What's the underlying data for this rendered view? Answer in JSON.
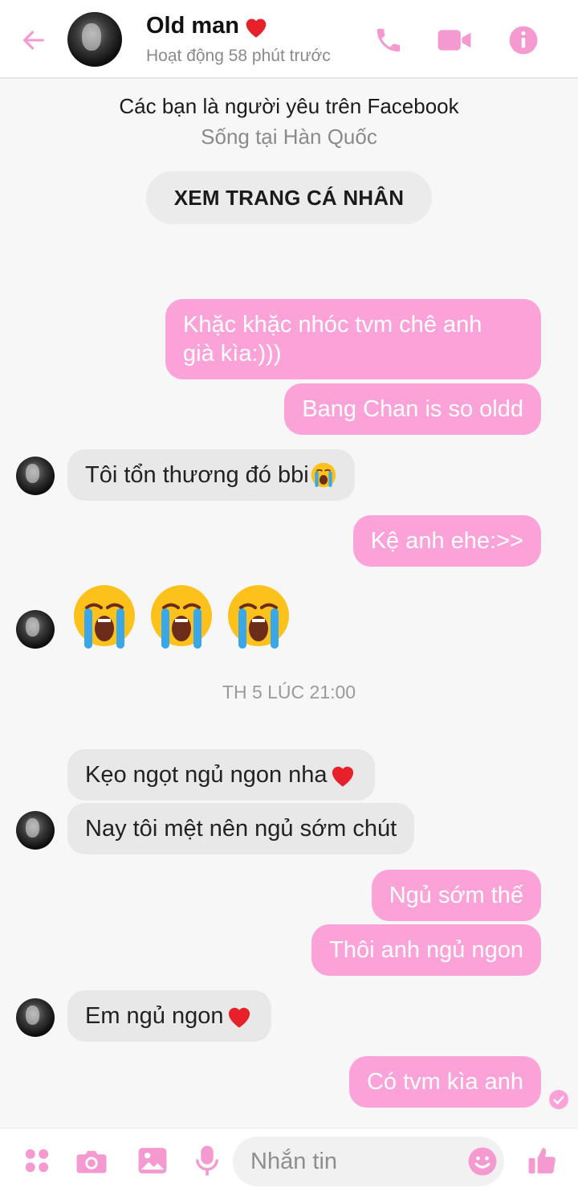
{
  "header": {
    "contact_name": "Old man",
    "status": "Hoạt động 58 phút trước",
    "accent": "#f59ad0",
    "icons": [
      "back-arrow-icon",
      "phone-icon",
      "video-camera-icon",
      "info-icon"
    ]
  },
  "intro": {
    "relationship": "Các bạn là người yêu trên Facebook",
    "location": "Sống tại Hàn Quốc",
    "profile_button": "XEM TRANG CÁ NHÂN"
  },
  "messages": [
    {
      "from": "me",
      "text": "Khặc khặc nhóc tvm chê anh\ngià kìa:)))"
    },
    {
      "from": "me",
      "text": "Bang Chan is so oldd"
    },
    {
      "from": "them",
      "text": "Tôi tổn thương đó bbi"
    },
    {
      "from": "me",
      "text": "Kệ anh ehe:>>"
    },
    {
      "from": "them",
      "text": "",
      "emoji": "loudly-crying-face x3"
    },
    {
      "from": "them",
      "text": "Kẹo ngọt ngủ ngon nha"
    },
    {
      "from": "them",
      "text": "Nay tôi mệt nên ngủ sớm chút"
    },
    {
      "from": "me",
      "text": "Ngủ sớm thế"
    },
    {
      "from": "me",
      "text": "Thôi anh ngủ ngon"
    },
    {
      "from": "them",
      "text": "Em ngủ ngon"
    },
    {
      "from": "me",
      "text": "Có tvm kìa anh"
    }
  ],
  "timestamp": "TH 5 LÚC 21:00",
  "composer": {
    "placeholder": "Nhắn tin",
    "icons": [
      "apps-grid-icon",
      "camera-icon",
      "gallery-icon",
      "microphone-icon",
      "emoji-icon",
      "thumbs-up-icon"
    ]
  },
  "colors": {
    "sent_bubble": "#fba3d9",
    "received_bubble": "#e8e8e8",
    "background": "#f7f7f7"
  }
}
